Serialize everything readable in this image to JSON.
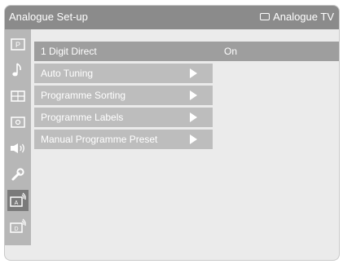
{
  "header": {
    "title": "Analogue Set-up",
    "source_label": "Analogue TV"
  },
  "sidebar": {
    "items": [
      {
        "name": "picture-icon"
      },
      {
        "name": "sound-music-note-icon"
      },
      {
        "name": "features-grid-icon"
      },
      {
        "name": "installation-icon"
      },
      {
        "name": "speaker-volume-icon"
      },
      {
        "name": "wrench-setup-icon"
      },
      {
        "name": "analogue-setup-icon",
        "selected": true
      },
      {
        "name": "digital-setup-icon"
      }
    ]
  },
  "menu": {
    "items": [
      {
        "label": "1 Digit Direct",
        "value": "On",
        "selected": true
      },
      {
        "label": "Auto Tuning",
        "has_submenu": true
      },
      {
        "label": "Programme Sorting",
        "has_submenu": true
      },
      {
        "label": "Programme Labels",
        "has_submenu": true
      },
      {
        "label": "Manual Programme Preset",
        "has_submenu": true
      }
    ]
  },
  "colors": {
    "header_bg": "#8b8b8b",
    "menu_item_bg": "#bdbdbd",
    "selected_bg": "#9e9e9e",
    "panel_bg": "#ebebeb",
    "sidebar_bg": "#b7b7b7"
  }
}
